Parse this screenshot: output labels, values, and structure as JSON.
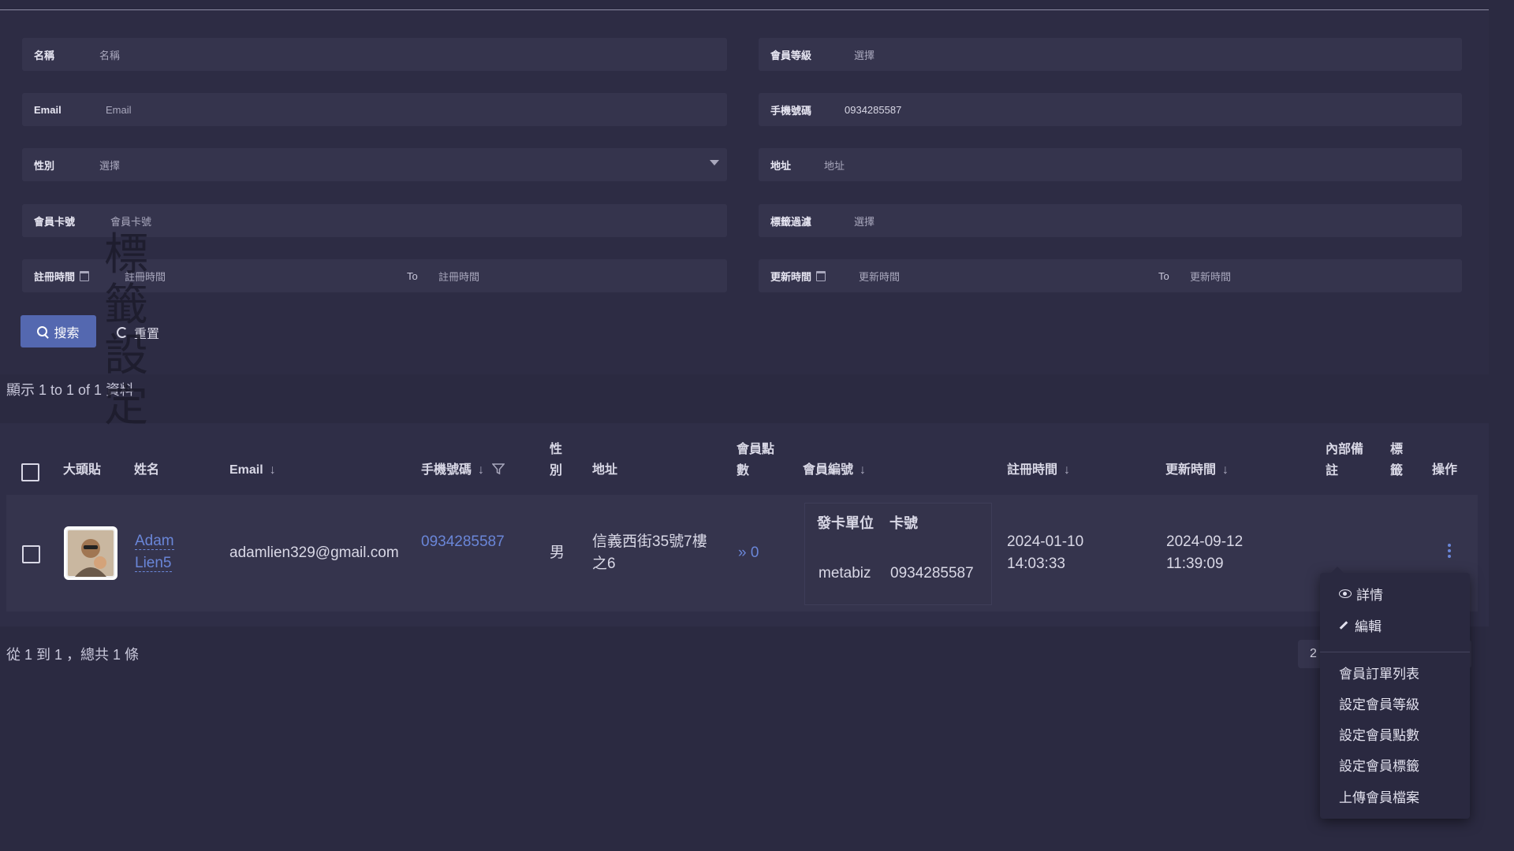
{
  "filters": {
    "name": {
      "label": "名稱",
      "placeholder": "名稱"
    },
    "level": {
      "label": "會員等級",
      "placeholder": "選擇"
    },
    "email": {
      "label": "Email",
      "placeholder": "Email"
    },
    "phone": {
      "label": "手機號碼",
      "value": "0934285587"
    },
    "gender": {
      "label": "性別",
      "placeholder": "選擇"
    },
    "address": {
      "label": "地址",
      "placeholder": "地址"
    },
    "card": {
      "label": "會員卡號",
      "placeholder": "會員卡號"
    },
    "tag": {
      "label": "標籤過濾",
      "placeholder": "選擇"
    },
    "reg": {
      "label": "註冊時間",
      "from": "註冊時間",
      "to_label": "To",
      "to": "註冊時間"
    },
    "upd": {
      "label": "更新時間",
      "from": "更新時間",
      "to_label": "To",
      "to": "更新時間"
    }
  },
  "buttons": {
    "search": "搜索",
    "reset": "重置"
  },
  "overlay_text": "標籤設定",
  "show_text": "顯示 1 to 1 of 1 資料",
  "table": {
    "headers": {
      "avatar": "大頭貼",
      "name": "姓名",
      "email": "Email",
      "phone": "手機號碼",
      "gender": "性別",
      "address": "地址",
      "points": "會員點數",
      "member_no": "會員編號",
      "reg_time": "註冊時間",
      "upd_time": "更新時間",
      "note": "內部備註",
      "tags": "標籤",
      "ops": "操作"
    },
    "row": {
      "name": "Adam Lien5",
      "email": "adamlien329@gmail.com",
      "phone": "0934285587",
      "gender": "男",
      "address": "信義西街35號7樓之6",
      "points_icon": "»",
      "points": "0",
      "card_headers": [
        "發卡單位",
        "卡號"
      ],
      "card_issuer": "metabiz",
      "card_no": "0934285587",
      "reg_date": "2024-01-10",
      "reg_clock": "14:03:33",
      "upd_date": "2024-09-12",
      "upd_clock": "11:39:09"
    }
  },
  "footer": {
    "summary": "從 1 到 1 ，總共 1 條",
    "pager_page": "2"
  },
  "menu": {
    "items": [
      "詳情",
      "編輯",
      "會員訂單列表",
      "設定會員等級",
      "設定會員點數",
      "設定會員標籤",
      "上傳會員檔案"
    ]
  },
  "colors": {
    "background": "#2b2a41",
    "field": "#35344d",
    "accent": "#5468b0",
    "link": "#6a86d8"
  }
}
